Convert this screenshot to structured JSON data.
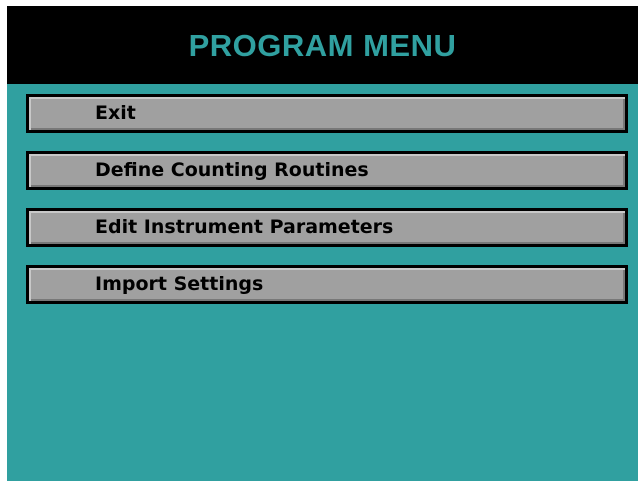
{
  "title": "PROGRAM MENU",
  "colors": {
    "background": "#30a0a0",
    "title_bar": "#000000",
    "title_text": "#30a0a0",
    "menu_button": "#a0a0a0",
    "menu_text": "#000000"
  },
  "menu": {
    "items": [
      {
        "label": "Exit"
      },
      {
        "label": "Define Counting Routines"
      },
      {
        "label": "Edit Instrument Parameters"
      },
      {
        "label": "Import Settings"
      }
    ]
  }
}
